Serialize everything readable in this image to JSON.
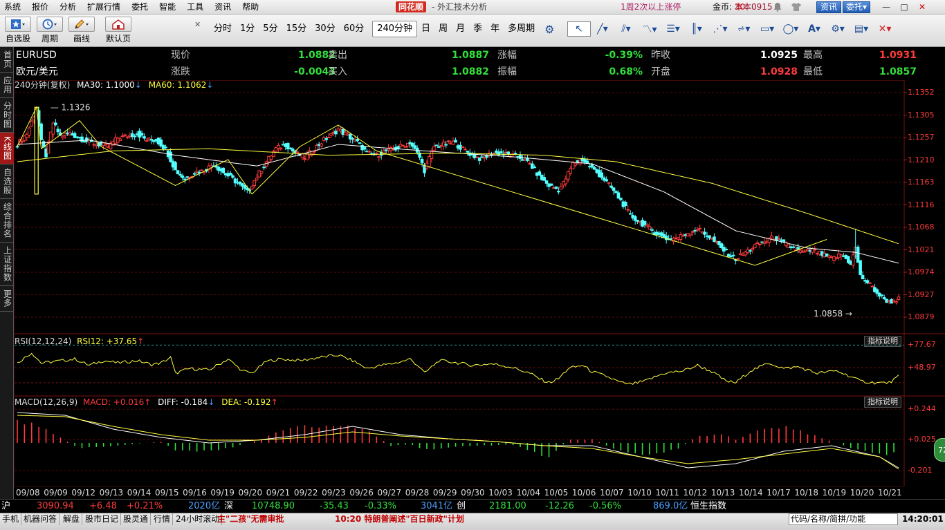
{
  "menu": [
    "系统",
    "报价",
    "分析",
    "扩展行情",
    "委托",
    "智能",
    "工具",
    "资讯",
    "帮助"
  ],
  "brand": {
    "logo": "同花顺",
    "title": "- 外汇技术分析"
  },
  "promo": "1周2次以上涨停",
  "coins": {
    "label": "金币:",
    "value": "30"
  },
  "version": "本本0915",
  "top_buttons": {
    "news": "资讯",
    "trade": "委托▾"
  },
  "window_controls": [
    "—",
    "□",
    "✕"
  ],
  "toolbar": {
    "big": [
      {
        "label": "自选股",
        "icon": "star-icon"
      },
      {
        "label": "周期",
        "icon": "clock-icon"
      },
      {
        "label": "画线",
        "icon": "pencil-icon"
      },
      {
        "label": "默认页",
        "icon": "home-icon"
      }
    ],
    "periods": [
      "分时",
      "1分",
      "5分",
      "15分",
      "30分",
      "60分",
      "240分钟",
      "日",
      "周",
      "月",
      "季",
      "年",
      "多周期"
    ],
    "active_period": "240分钟",
    "draw_tools": [
      "pointer-icon",
      "line-icon",
      "parallel-icon",
      "wave-icon",
      "fib-icon",
      "bars-icon",
      "chart-icon",
      "channel-icon",
      "rect-icon",
      "ellipse-icon",
      "text-icon",
      "gear-icon",
      "save-icon",
      "delete-icon"
    ]
  },
  "sidebar": [
    "首页",
    "应用",
    "分时图",
    "K线图",
    "自选股",
    "综合排名",
    "上证指数",
    "更多"
  ],
  "sidebar_active": "K线图",
  "quote": {
    "symbol": "EURUSD",
    "name": "欧元/美元",
    "items_row1": [
      {
        "label": "现价",
        "value": "1.0882",
        "color": "dn"
      },
      {
        "label": "卖出",
        "value": "1.0887",
        "color": "dn"
      },
      {
        "label": "涨幅",
        "value": "-0.39%",
        "color": "dn"
      },
      {
        "label": "昨收",
        "value": "1.0925",
        "color": "wh"
      },
      {
        "label": "最高",
        "value": "1.0931",
        "color": "up"
      }
    ],
    "items_row2": [
      {
        "label": "涨跌",
        "value": "-0.0043",
        "color": "dn"
      },
      {
        "label": "买入",
        "value": "1.0882",
        "color": "dn"
      },
      {
        "label": "振幅",
        "value": "0.68%",
        "color": "dn"
      },
      {
        "label": "开盘",
        "value": "1.0928",
        "color": "up"
      },
      {
        "label": "最低",
        "value": "1.0857",
        "color": "dn"
      }
    ]
  },
  "legend": {
    "period": "240分钟(复权)",
    "ma30": "MA30: 1.1000",
    "ma60": "MA60: 1.1062",
    "rsi": "RSI(12,12,24)",
    "rsi_val": "RSI12: +37.65",
    "macd": "MACD(12,26,9)",
    "macd_val": "MACD: +0.016",
    "diff": "DIFF: -0.184",
    "dea": "DEA: -0.192",
    "help": "指标说明"
  },
  "chart_data": {
    "type": "candlestick",
    "price_axis": {
      "ticks": [
        "1.1352",
        "1.1305",
        "1.1257",
        "1.1210",
        "1.1163",
        "1.1116",
        "1.1068",
        "1.1021",
        "1.0974",
        "1.0927",
        "1.0879"
      ],
      "range": [
        1.084,
        1.136
      ]
    },
    "rsi_axis": {
      "ticks": [
        "+77.67",
        "+48.97"
      ]
    },
    "macd_axis": {
      "ticks": [
        "+0.244",
        "+0.025",
        "-0.201"
      ]
    },
    "dates": [
      "09/08",
      "09/09",
      "09/12",
      "09/13",
      "09/14",
      "09/15",
      "09/16",
      "09/19",
      "09/20",
      "09/21",
      "09/22",
      "09/23",
      "09/26",
      "09/27",
      "09/28",
      "09/29",
      "09/30",
      "10/03",
      "10/04",
      "10/05",
      "10/06",
      "10/07",
      "10/10",
      "10/11",
      "10/12",
      "10/13",
      "10/14",
      "10/17",
      "10/18",
      "10/19",
      "10/20",
      "10/21"
    ],
    "annotations": {
      "high": "1.1326",
      "low": "1.0858"
    },
    "close_keypoints": [
      [
        0,
        1.124
      ],
      [
        4,
        1.1265
      ],
      [
        8,
        1.132
      ],
      [
        10,
        1.1245
      ],
      [
        12,
        1.1215
      ],
      [
        15,
        1.129
      ],
      [
        18,
        1.126
      ],
      [
        22,
        1.1265
      ],
      [
        26,
        1.1255
      ],
      [
        30,
        1.1245
      ],
      [
        34,
        1.124
      ],
      [
        38,
        1.1235
      ],
      [
        42,
        1.1255
      ],
      [
        46,
        1.126
      ],
      [
        50,
        1.1265
      ],
      [
        54,
        1.125
      ],
      [
        58,
        1.125
      ],
      [
        62,
        1.123
      ],
      [
        66,
        1.118
      ],
      [
        70,
        1.116
      ],
      [
        74,
        1.1175
      ],
      [
        78,
        1.118
      ],
      [
        82,
        1.1195
      ],
      [
        86,
        1.1175
      ],
      [
        90,
        1.116
      ],
      [
        94,
        1.114
      ],
      [
        96,
        1.113
      ],
      [
        100,
        1.1165
      ],
      [
        104,
        1.12
      ],
      [
        108,
        1.123
      ],
      [
        112,
        1.124
      ],
      [
        116,
        1.122
      ],
      [
        120,
        1.121
      ],
      [
        124,
        1.123
      ],
      [
        128,
        1.125
      ],
      [
        132,
        1.1265
      ],
      [
        134,
        1.1275
      ],
      [
        138,
        1.126
      ],
      [
        142,
        1.1245
      ],
      [
        146,
        1.122
      ],
      [
        150,
        1.1215
      ],
      [
        154,
        1.1225
      ],
      [
        158,
        1.123
      ],
      [
        162,
        1.124
      ],
      [
        164,
        1.1245
      ],
      [
        168,
        1.121
      ],
      [
        170,
        1.118
      ],
      [
        174,
        1.1235
      ],
      [
        178,
        1.124
      ],
      [
        182,
        1.1245
      ],
      [
        186,
        1.123
      ],
      [
        190,
        1.1215
      ],
      [
        194,
        1.1205
      ],
      [
        198,
        1.122
      ],
      [
        202,
        1.122
      ],
      [
        206,
        1.1215
      ],
      [
        210,
        1.121
      ],
      [
        214,
        1.1195
      ],
      [
        218,
        1.1165
      ],
      [
        222,
        1.1145
      ],
      [
        226,
        1.1135
      ],
      [
        228,
        1.115
      ],
      [
        232,
        1.1195
      ],
      [
        236,
        1.1205
      ],
      [
        240,
        1.1185
      ],
      [
        244,
        1.1165
      ],
      [
        248,
        1.114
      ],
      [
        252,
        1.111
      ],
      [
        256,
        1.1075
      ],
      [
        260,
        1.106
      ],
      [
        264,
        1.1045
      ],
      [
        268,
        1.103
      ],
      [
        272,
        1.102
      ],
      [
        276,
        1.1025
      ],
      [
        280,
        1.1035
      ],
      [
        284,
        1.1045
      ],
      [
        288,
        1.103
      ],
      [
        292,
        1.101
      ],
      [
        296,
        1.099
      ],
      [
        300,
        1.0975
      ],
      [
        304,
        1.099
      ],
      [
        308,
        1.1005
      ],
      [
        312,
        1.1015
      ],
      [
        316,
        1.1025
      ],
      [
        320,
        1.101
      ],
      [
        324,
        1.1
      ],
      [
        328,
        1.099
      ],
      [
        332,
        1.0995
      ],
      [
        336,
        1.0985
      ],
      [
        340,
        1.0975
      ],
      [
        344,
        1.0985
      ],
      [
        348,
        1.0965
      ],
      [
        350,
        1.1
      ],
      [
        352,
        1.0935
      ],
      [
        356,
        1.0915
      ],
      [
        360,
        1.089
      ],
      [
        364,
        1.0875
      ],
      [
        368,
        1.0882
      ]
    ],
    "ma30_keypoints": [
      [
        0,
        1.124
      ],
      [
        30,
        1.125
      ],
      [
        66,
        1.1215
      ],
      [
        100,
        1.119
      ],
      [
        134,
        1.124
      ],
      [
        170,
        1.1225
      ],
      [
        210,
        1.121
      ],
      [
        240,
        1.1195
      ],
      [
        270,
        1.113
      ],
      [
        300,
        1.104
      ],
      [
        330,
        1.1
      ],
      [
        350,
        1.099
      ],
      [
        368,
        1.0965
      ]
    ],
    "ma60_keypoints": [
      [
        0,
        1.12
      ],
      [
        40,
        1.1225
      ],
      [
        80,
        1.123
      ],
      [
        130,
        1.1215
      ],
      [
        180,
        1.122
      ],
      [
        220,
        1.1215
      ],
      [
        250,
        1.12
      ],
      [
        290,
        1.115
      ],
      [
        330,
        1.108
      ],
      [
        368,
        1.101
      ]
    ],
    "zigzag": [
      [
        0,
        1.1235
      ],
      [
        8,
        1.1326
      ],
      [
        10,
        1.123
      ],
      [
        20,
        1.127
      ],
      [
        26,
        1.1295
      ],
      [
        35,
        1.1235
      ],
      [
        66,
        1.1145
      ],
      [
        88,
        1.1205
      ],
      [
        98,
        1.1125
      ],
      [
        118,
        1.1235
      ],
      [
        134,
        1.1285
      ],
      [
        150,
        1.1225
      ],
      [
        308,
        1.096
      ],
      [
        338,
        1.102
      ]
    ],
    "rsi_keypoints": [
      [
        0,
        55
      ],
      [
        6,
        68
      ],
      [
        10,
        55
      ],
      [
        16,
        57
      ],
      [
        24,
        60
      ],
      [
        30,
        52
      ],
      [
        36,
        58
      ],
      [
        42,
        55
      ],
      [
        50,
        58
      ],
      [
        56,
        53
      ],
      [
        60,
        55
      ],
      [
        64,
        62
      ],
      [
        66,
        42
      ],
      [
        72,
        48
      ],
      [
        80,
        46
      ],
      [
        88,
        60
      ],
      [
        94,
        45
      ],
      [
        98,
        42
      ],
      [
        104,
        57
      ],
      [
        110,
        60
      ],
      [
        118,
        58
      ],
      [
        126,
        62
      ],
      [
        134,
        65
      ],
      [
        140,
        58
      ],
      [
        146,
        48
      ],
      [
        152,
        52
      ],
      [
        158,
        55
      ],
      [
        162,
        58
      ],
      [
        164,
        60
      ],
      [
        168,
        50
      ],
      [
        170,
        42
      ],
      [
        176,
        58
      ],
      [
        182,
        56
      ],
      [
        190,
        52
      ],
      [
        198,
        54
      ],
      [
        206,
        50
      ],
      [
        214,
        42
      ],
      [
        218,
        35
      ],
      [
        222,
        30
      ],
      [
        226,
        35
      ],
      [
        230,
        48
      ],
      [
        236,
        52
      ],
      [
        240,
        44
      ],
      [
        246,
        38
      ],
      [
        252,
        30
      ],
      [
        256,
        28
      ],
      [
        262,
        32
      ],
      [
        270,
        42
      ],
      [
        278,
        45
      ],
      [
        284,
        52
      ],
      [
        290,
        44
      ],
      [
        296,
        32
      ],
      [
        300,
        30
      ],
      [
        306,
        45
      ],
      [
        314,
        55
      ],
      [
        320,
        48
      ],
      [
        326,
        50
      ],
      [
        334,
        42
      ],
      [
        342,
        45
      ],
      [
        348,
        38
      ],
      [
        352,
        32
      ],
      [
        358,
        30
      ],
      [
        364,
        30
      ],
      [
        368,
        38
      ]
    ],
    "macd_hist_keypoints": [
      [
        0,
        0.15
      ],
      [
        10,
        0.12
      ],
      [
        20,
        0.02
      ],
      [
        26,
        -0.04
      ],
      [
        40,
        -0.02
      ],
      [
        60,
        0.01
      ],
      [
        66,
        -0.05
      ],
      [
        80,
        -0.06
      ],
      [
        90,
        -0.03
      ],
      [
        100,
        0.02
      ],
      [
        110,
        0.08
      ],
      [
        118,
        0.12
      ],
      [
        134,
        0.13
      ],
      [
        146,
        0.09
      ],
      [
        156,
        -0.02
      ],
      [
        164,
        -0.01
      ],
      [
        170,
        -0.05
      ],
      [
        180,
        -0.03
      ],
      [
        194,
        -0.02
      ],
      [
        206,
        -0.01
      ],
      [
        214,
        -0.06
      ],
      [
        222,
        -0.1
      ],
      [
        230,
        0.02
      ],
      [
        240,
        0.03
      ],
      [
        250,
        -0.05
      ],
      [
        260,
        -0.08
      ],
      [
        268,
        -0.07
      ],
      [
        276,
        -0.04
      ],
      [
        284,
        0.05
      ],
      [
        294,
        0.07
      ],
      [
        300,
        0.02
      ],
      [
        310,
        0.09
      ],
      [
        318,
        0.12
      ],
      [
        326,
        0.09
      ],
      [
        334,
        0.05
      ],
      [
        342,
        0.0
      ],
      [
        350,
        -0.05
      ],
      [
        360,
        -0.08
      ],
      [
        368,
        -0.07
      ]
    ],
    "diff_keypoints": [
      [
        0,
        0.22
      ],
      [
        20,
        0.2
      ],
      [
        40,
        0.1
      ],
      [
        60,
        0.04
      ],
      [
        80,
        0.0
      ],
      [
        100,
        0.02
      ],
      [
        120,
        0.06
      ],
      [
        140,
        0.12
      ],
      [
        160,
        0.06
      ],
      [
        180,
        0.03
      ],
      [
        200,
        0.01
      ],
      [
        220,
        -0.02
      ],
      [
        240,
        -0.02
      ],
      [
        260,
        -0.1
      ],
      [
        280,
        -0.18
      ],
      [
        300,
        -0.15
      ],
      [
        320,
        -0.06
      ],
      [
        340,
        -0.02
      ],
      [
        360,
        -0.1
      ],
      [
        368,
        -0.18
      ]
    ],
    "dea_keypoints": [
      [
        0,
        0.2
      ],
      [
        20,
        0.19
      ],
      [
        40,
        0.12
      ],
      [
        60,
        0.06
      ],
      [
        80,
        0.02
      ],
      [
        100,
        0.02
      ],
      [
        120,
        0.04
      ],
      [
        140,
        0.08
      ],
      [
        160,
        0.05
      ],
      [
        180,
        0.03
      ],
      [
        200,
        0.01
      ],
      [
        220,
        -0.02
      ],
      [
        240,
        -0.04
      ],
      [
        260,
        -0.1
      ],
      [
        280,
        -0.15
      ],
      [
        300,
        -0.12
      ],
      [
        320,
        -0.08
      ],
      [
        340,
        -0.04
      ],
      [
        360,
        -0.1
      ],
      [
        368,
        -0.19
      ]
    ]
  },
  "status": {
    "sh": {
      "label": "沪",
      "price": "3090.94",
      "chg": "+6.48",
      "pct": "+0.21%",
      "vol": "2020亿"
    },
    "sz": {
      "label": "深",
      "price": "10748.90",
      "chg": "-35.43",
      "pct": "-0.33%",
      "vol": "3041亿"
    },
    "cy": {
      "label": "创",
      "price": "2181.00",
      "chg": "-12.26",
      "pct": "-0.56%",
      "vol": "869.0亿"
    },
    "hs": {
      "label": "恒生指数"
    }
  },
  "bottom": {
    "tabs": [
      "手机",
      "机器问答",
      "解盘",
      "股市日记",
      "股灵通",
      "行情",
      "24小时滚动"
    ],
    "ticker1": "主\"二孩\"无需审批",
    "ticker2": "10:20 特朗普阐述\"百日新政\"计划",
    "search_placeholder": "代码/名称/简拼/功能",
    "clock": "14:20:01"
  },
  "float_badge": "72"
}
